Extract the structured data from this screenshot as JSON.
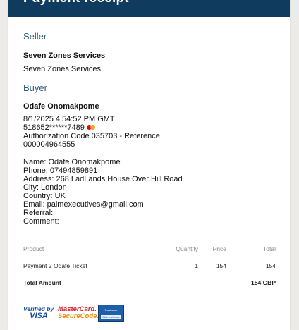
{
  "header": {
    "title": "Payment receipt"
  },
  "seller": {
    "heading": "Seller",
    "name_bold": "Seven Zones Services",
    "name": "Seven Zones Services"
  },
  "buyer": {
    "heading": "Buyer",
    "name_bold": "Odafe Onomakpome",
    "datetime": "8/1/2025 4:54:52 PM GMT",
    "card_number": "518652******7489",
    "auth_line1": "Authorization Code 035703 - Reference",
    "auth_line2": "000004964555",
    "details": [
      "Name: Odafe Onomakpome",
      "Phone: 07494859891",
      "Address: 268 LadLands House Over Hill Road",
      "City: London",
      "Country: UK",
      "Email: palmexecutives@gmail.com",
      "Referral:",
      "Comment:"
    ]
  },
  "table": {
    "headers": {
      "product": "Product",
      "quantity": "Quantity",
      "price": "Price",
      "total": "Total"
    },
    "rows": [
      {
        "product": "Payment 2 Odafe Ticket",
        "quantity": "1",
        "price": "154",
        "total": "154"
      }
    ],
    "total_label": "Total Amount",
    "total_value": "154 GBP"
  },
  "logos": {
    "verified_line1": "Verified by",
    "verified_line2": "VISA",
    "mastercard_line1": "MasterCard.",
    "mastercard_line2": "SecureCode.",
    "trustwave_line1": "Trustwave",
    "trustwave_line2": "Click to Validate"
  },
  "colors": {
    "header_bg": "#0f3b5f",
    "section_heading": "#2a5d80",
    "page_bg": "#ecebe7"
  }
}
